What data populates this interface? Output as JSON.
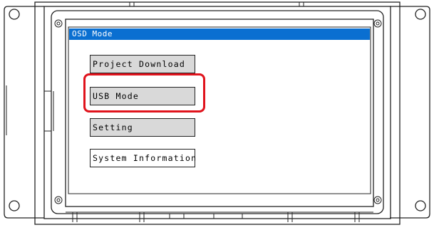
{
  "osd": {
    "title": "OSD Mode",
    "menu": [
      {
        "label": "Project Download"
      },
      {
        "label": "USB Mode"
      },
      {
        "label": "Setting"
      },
      {
        "label": "System Information"
      }
    ]
  },
  "colors": {
    "title_bar": "#0a6fd1",
    "button_fill": "#d9d9d9",
    "highlight": "#e0131c"
  }
}
